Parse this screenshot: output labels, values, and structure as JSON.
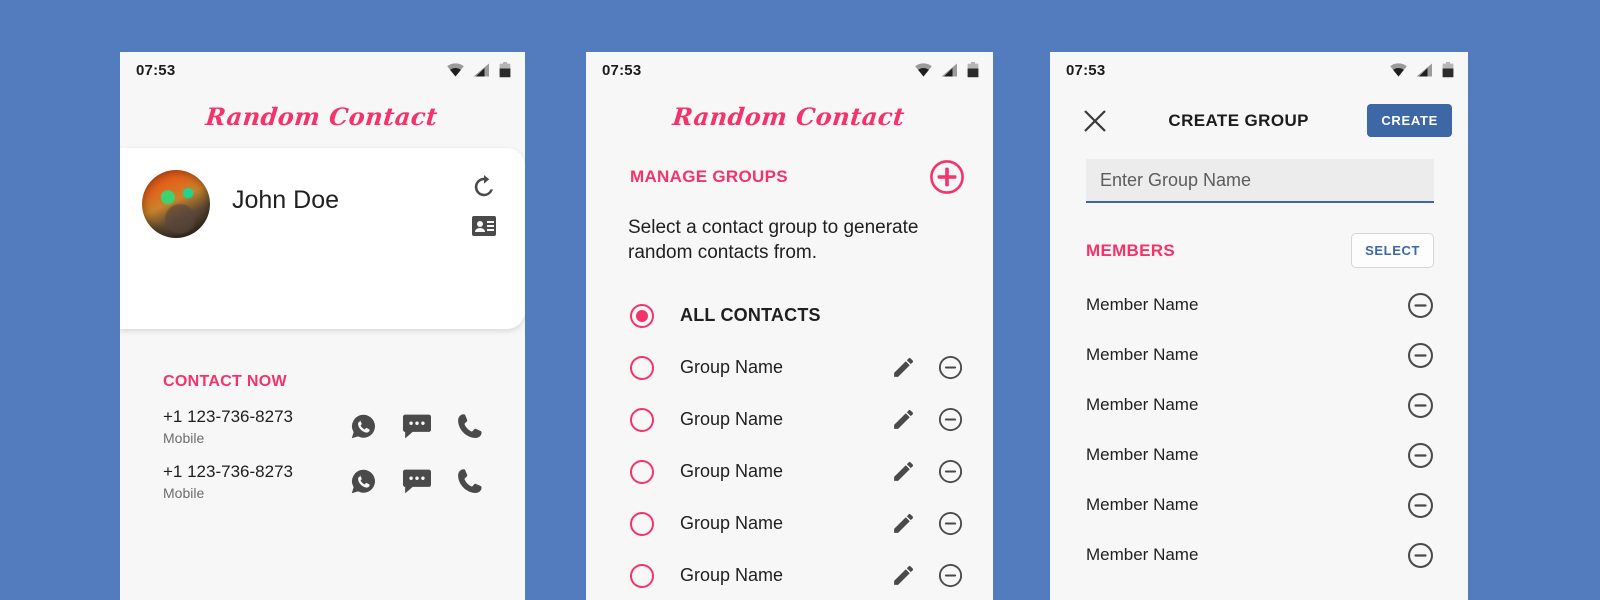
{
  "background_color": "#527cbd",
  "accent_pink": "#f4336a",
  "accent_blue": "#3d67a5",
  "status_bar": {
    "time": "07:53",
    "icons": [
      "wifi-icon",
      "signal-icon",
      "battery-icon"
    ]
  },
  "brand": {
    "title": "Random Contact"
  },
  "screen_contact": {
    "card": {
      "avatar_alt": "contact-photo",
      "name": "John Doe",
      "actions": [
        "refresh-icon",
        "contact-card-icon"
      ]
    },
    "section_label": "CONTACT NOW",
    "phones": [
      {
        "number": "+1 123-736-8273",
        "type": "Mobile",
        "actions": [
          "whatsapp-icon",
          "message-icon",
          "call-icon"
        ]
      },
      {
        "number": "+1 123-736-8273",
        "type": "Mobile",
        "actions": [
          "whatsapp-icon",
          "message-icon",
          "call-icon"
        ]
      }
    ]
  },
  "screen_groups": {
    "section_label": "MANAGE GROUPS",
    "add_icon": "plus-circle-icon",
    "description": "Select a contact group to generate random contacts from.",
    "items": [
      {
        "label": "ALL CONTACTS",
        "selected": true,
        "emphasis": true,
        "has_actions": false
      },
      {
        "label": "Group Name",
        "selected": false,
        "emphasis": false,
        "has_actions": true
      },
      {
        "label": "Group Name",
        "selected": false,
        "emphasis": false,
        "has_actions": true
      },
      {
        "label": "Group Name",
        "selected": false,
        "emphasis": false,
        "has_actions": true
      },
      {
        "label": "Group Name",
        "selected": false,
        "emphasis": false,
        "has_actions": true
      },
      {
        "label": "Group Name",
        "selected": false,
        "emphasis": false,
        "has_actions": true
      }
    ]
  },
  "screen_create_group": {
    "close_icon": "close-icon",
    "title": "CREATE GROUP",
    "create_label": "CREATE",
    "group_name_value": "",
    "group_name_placeholder": "Enter Group Name",
    "members_label": "MEMBERS",
    "select_label": "SELECT",
    "members": [
      {
        "name": "Member Name",
        "action": "remove-icon"
      },
      {
        "name": "Member Name",
        "action": "remove-icon"
      },
      {
        "name": "Member Name",
        "action": "remove-icon"
      },
      {
        "name": "Member Name",
        "action": "remove-icon"
      },
      {
        "name": "Member Name",
        "action": "remove-icon"
      },
      {
        "name": "Member Name",
        "action": "remove-icon"
      }
    ]
  }
}
